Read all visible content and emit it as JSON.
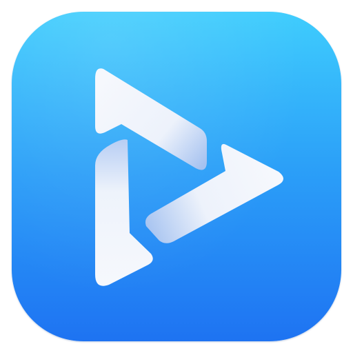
{
  "icon": {
    "name": "play-icon",
    "background_top": "#3fcdfd",
    "background_bottom": "#1e73f2",
    "glyph_color": "#f4f7fc",
    "glyph_shade": "#a9c4f2"
  }
}
